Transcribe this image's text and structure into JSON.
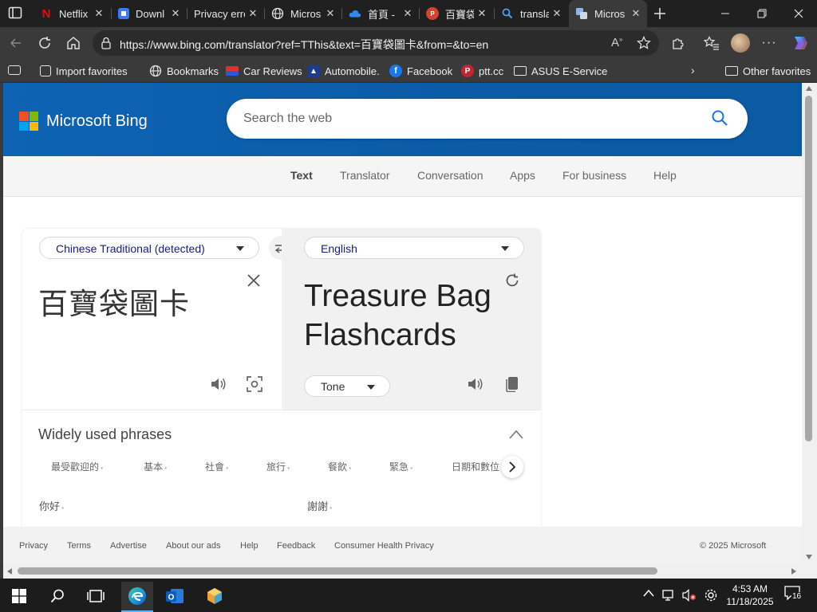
{
  "browser": {
    "tabs": [
      {
        "title": "Netflix",
        "icon": "netflix-icon"
      },
      {
        "title": "Downl",
        "icon": "roblox-icon"
      },
      {
        "title": "Privacy error",
        "icon": ""
      },
      {
        "title": "Micros",
        "icon": "globe-icon"
      },
      {
        "title": "首頁 -",
        "icon": "onedrive-icon"
      },
      {
        "title": "百寶袋",
        "icon": "pdf-icon"
      },
      {
        "title": "transla",
        "icon": "search-icon"
      },
      {
        "title": "Micros",
        "icon": "translator-icon",
        "active": true
      }
    ],
    "url": "https://www.bing.com/translator?ref=TThis&text=百寶袋圖卡&from=&to=en",
    "favorites": [
      {
        "label": "Import favorites",
        "icon": "import-icon"
      },
      {
        "label": "Bookmarks",
        "icon": "globe-icon"
      },
      {
        "label": "Car Reviews",
        "icon": "car-icon"
      },
      {
        "label": "Automobile.",
        "icon": "a-icon"
      },
      {
        "label": "Facebook",
        "icon": "facebook-icon"
      },
      {
        "label": "ptt.cc",
        "icon": "p-icon"
      },
      {
        "label": "ASUS E-Service",
        "icon": "folder-icon"
      },
      {
        "label": "Other favorites",
        "icon": "folder-icon"
      }
    ]
  },
  "page": {
    "logo_text": "Microsoft Bing",
    "search_placeholder": "Search the web",
    "subnav": [
      "Text",
      "Translator",
      "Conversation",
      "Apps",
      "For business",
      "Help"
    ],
    "active_subnav": "Text",
    "translator": {
      "source_lang": "Chinese Traditional (detected)",
      "target_lang": "English",
      "source_text": "百寶袋圖卡",
      "target_text": "Treasure Bag Flashcards",
      "tone_label": "Tone"
    },
    "phrases": {
      "title": "Widely used phrases",
      "categories": [
        "最受歡迎的",
        "基本",
        "社會",
        "旅行",
        "餐飲",
        "緊急",
        "日期和數位"
      ],
      "items": [
        "你好",
        "謝謝"
      ]
    },
    "footer": {
      "links": [
        "Privacy",
        "Terms",
        "Advertise",
        "About our ads",
        "Help",
        "Feedback",
        "Consumer Health Privacy"
      ],
      "copyright": "© 2025 Microsoft"
    }
  },
  "taskbar": {
    "time": "4:53 AM",
    "date": "11/18/2025",
    "notification_count": "16"
  },
  "colors": {
    "bing_blue": "#0e63b3",
    "tab_bg": "#202020",
    "toolbar_bg": "#3a3a3a",
    "link_blue": "#1a1a80"
  }
}
